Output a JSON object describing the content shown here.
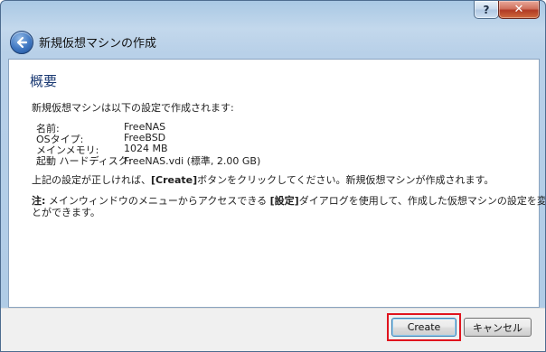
{
  "window": {
    "help_label": "?",
    "close_label": "✕",
    "title": "新規仮想マシンの作成",
    "back_icon": "back-arrow-icon",
    "accent_color": "#1b3a73"
  },
  "content": {
    "heading": "概要",
    "intro": "新規仮想マシンは以下の設定で作成されます:",
    "settings": [
      {
        "label": "名前:",
        "value": "FreeNAS"
      },
      {
        "label": "OSタイプ:",
        "value": "FreeBSD"
      },
      {
        "label": "メインメモリ:",
        "value": "1024 MB"
      },
      {
        "label": "起動 ハードディスク:",
        "value": "FreeNAS.vdi (標準, 2.00 GB)"
      }
    ],
    "confirm_pre": "上記の設定が正しければ、",
    "confirm_bold": "[Create]",
    "confirm_post": "ボタンをクリックしてください。新規仮想マシンが作成されます。",
    "note_bold1": "注:",
    "note_pre": " メインウィンドウのメニューからアクセスできる ",
    "note_bold2": "[設定]",
    "note_post_line1": "ダイアログを使用して、作成した仮想マシンの設定を変更するこ",
    "note_line2": "とができます。"
  },
  "buttons": {
    "create": "Create",
    "cancel": "キャンセル"
  }
}
